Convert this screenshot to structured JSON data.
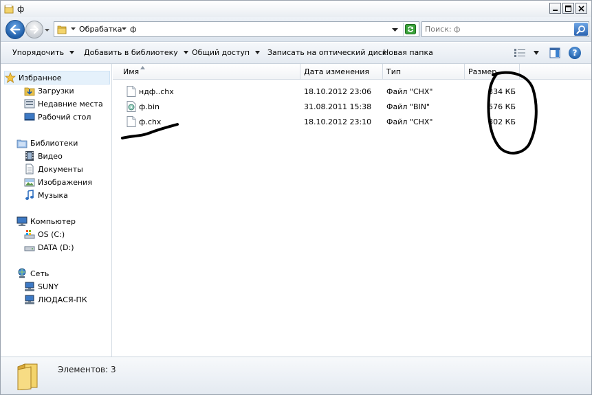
{
  "window": {
    "title": "ф",
    "controls": {
      "minimize": "minimize",
      "maximize": "maximize",
      "close": "close"
    }
  },
  "address": {
    "crumbs": [
      "Обрабатка",
      "ф"
    ]
  },
  "search": {
    "placeholder": "Поиск: ф"
  },
  "commands": [
    {
      "label": "Упорядочить",
      "has_menu": true
    },
    {
      "label": "Добавить в библиотеку",
      "has_menu": true
    },
    {
      "label": "Общий доступ",
      "has_menu": true
    },
    {
      "label": "Записать на оптический диск",
      "has_menu": false
    },
    {
      "label": "Новая папка",
      "has_menu": false
    }
  ],
  "help_label": "?",
  "nav": {
    "favorites": {
      "label": "Избранное",
      "items": [
        "Загрузки",
        "Недавние места",
        "Рабочий стол"
      ]
    },
    "libraries": {
      "label": "Библиотеки",
      "items": [
        "Видео",
        "Документы",
        "Изображения",
        "Музыка"
      ]
    },
    "computer": {
      "label": "Компьютер",
      "items": [
        "OS (C:)",
        "DATA (D:)"
      ]
    },
    "network": {
      "label": "Сеть",
      "items": [
        "SUNY",
        "ЛЮДАСЯ-ПК"
      ]
    }
  },
  "columns": {
    "name": "Имя",
    "date": "Дата изменения",
    "type": "Тип",
    "size": "Размер"
  },
  "files": [
    {
      "name": "ндф..chx",
      "date": "18.10.2012 23:06",
      "type": "Файл \"CHX\"",
      "size": "334 КБ",
      "icon": "document-icon"
    },
    {
      "name": "ф.bin",
      "date": "31.08.2011 15:38",
      "type": "Файл \"BIN\"",
      "size": "576 КБ",
      "icon": "disc-image-icon"
    },
    {
      "name": "ф.chx",
      "date": "18.10.2012 23:10",
      "type": "Файл \"CHX\"",
      "size": "302 КБ",
      "icon": "document-icon"
    }
  ],
  "status": {
    "label": "Элементов: 3"
  },
  "colors": {
    "accent": "#1f5ea8",
    "selection": "#e5f1fb",
    "scribble": "#000000"
  }
}
